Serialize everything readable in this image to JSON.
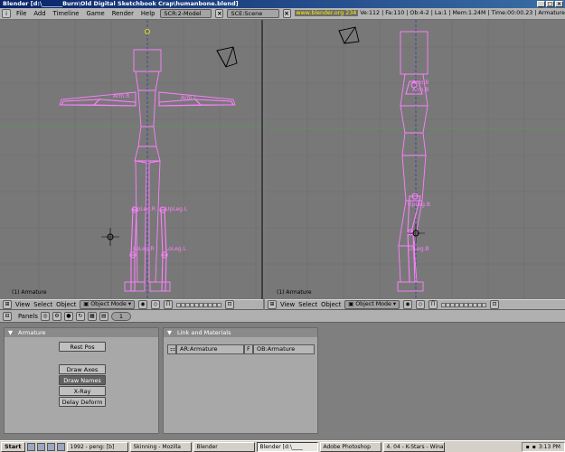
{
  "window": {
    "title": "Blender [d:\\_______Burn\\Old Digital Sketchbook Crap\\humanbone.blend]",
    "min": "_",
    "max": "□",
    "close": "×"
  },
  "menubar": {
    "info_icon": "i",
    "items": [
      "File",
      "Add",
      "Timeline",
      "Game",
      "Render",
      "Help"
    ],
    "screen": "SCR:2-Model",
    "scene": "SCE:Scene",
    "url": "www.blender.org 234",
    "stats": "Ve:112 | Fa:110 | Ob:4-2 | La:1 | Mem:1.24M | Time:00:00.23 | Armature"
  },
  "viewports": [
    {
      "label": "(1) Armature",
      "bones": [
        "Arm.R",
        "Arm.L",
        "UpLeg.R",
        "UpLeg.L",
        "LoLeg.R",
        "LoLeg.L"
      ]
    },
    {
      "label": "(1) Armature",
      "bones": [
        "Arm.B",
        "Arm.B",
        "UpLeg.B",
        "LoLeg.B"
      ]
    }
  ],
  "viewport_header": {
    "menus": [
      "View",
      "Select",
      "Object"
    ],
    "mode": "Object Mode"
  },
  "buttons_header": {
    "panels_label": "Panels",
    "page": "1"
  },
  "armature_panel": {
    "title": "Armature",
    "rest_pos": "Rest Pos",
    "draw_axes": "Draw Axes",
    "draw_names": "Draw Names",
    "xray": "X-Ray",
    "delay_deform": "Delay Deform"
  },
  "link_panel": {
    "title": "Link and Materials",
    "ar_field": "AR:Armature",
    "f_btn": "F",
    "ob_field": "OB:Armature"
  },
  "taskbar": {
    "start": "Start",
    "tasks": [
      "1992 - peng: [b]",
      "Skinning - Mozilla",
      "Blender",
      "Blender [d:\\____",
      "Adobe Photoshop",
      "4. 04 - K-Stars - Winamp"
    ],
    "time": "3:13 PM"
  },
  "colors": {
    "bone": "#ff80ff",
    "viewport_bg": "#787878",
    "grid": "#6c6c6c",
    "axis_green": "#5a9a5a"
  }
}
